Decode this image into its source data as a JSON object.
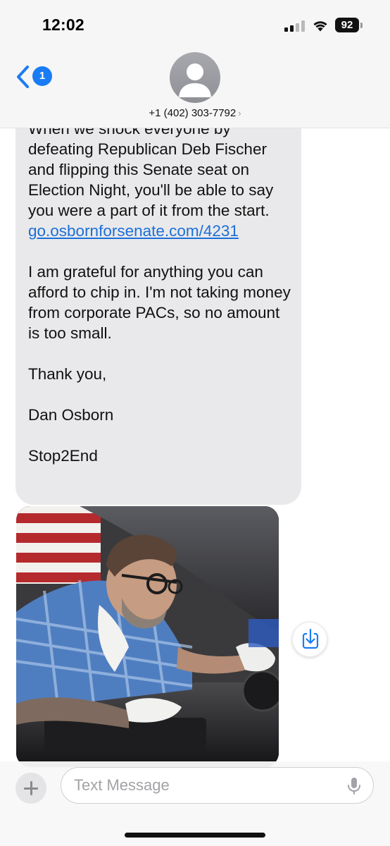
{
  "status_bar": {
    "time": "12:02",
    "battery_level": "92",
    "signal_bars_filled": 2,
    "signal_bars_total": 4
  },
  "header": {
    "back_badge_count": "1",
    "contact_name": "+1 (402) 303-7792",
    "chevron": "›"
  },
  "message": {
    "partial_top_line": "When we shock everyone by",
    "paragraph1_prefix": "defeating Republican Deb Fischer and flipping this Senate seat on Election Night, you'll be able to say you were a part of it from the start.",
    "link_text": "go.osbornforsenate.com/4231",
    "paragraph2": "I am grateful for anything you can afford to chip in. I'm not taking money from corporate PACs, so no amount is too small.",
    "closing": "Thank you,",
    "signature": "Dan Osborn",
    "opt_out": "Stop2End"
  },
  "attachment": {
    "description": "Photo of a man in a blue plaid shirt and glasses working under the hood of a car with an American flag behind him",
    "save_icon": "save-to-photos-icon"
  },
  "composer": {
    "placeholder": "Text Message",
    "plus_icon": "plus-icon",
    "mic_icon": "microphone-icon"
  },
  "colors": {
    "accent_blue": "#1a7cf5",
    "bubble_gray": "#e9e9eb",
    "link_blue": "#1b6fd8"
  }
}
